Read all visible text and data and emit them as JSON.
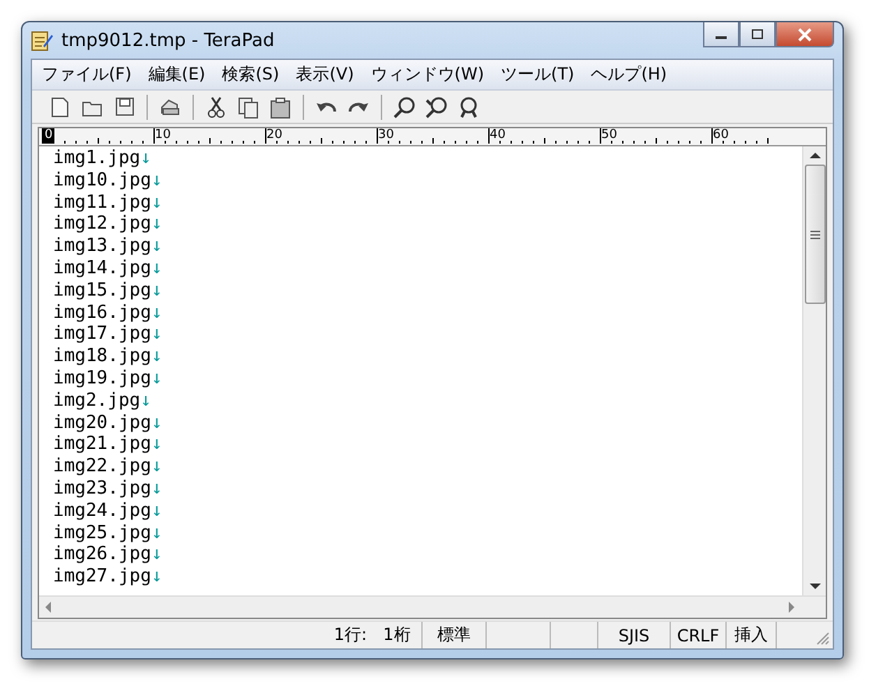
{
  "window": {
    "title": "tmp9012.tmp - TeraPad"
  },
  "menu": [
    "ファイル(F)",
    "編集(E)",
    "検索(S)",
    "表示(V)",
    "ウィンドウ(W)",
    "ツール(T)",
    "ヘルプ(H)"
  ],
  "ruler": [
    "0",
    "10",
    "20",
    "30",
    "40",
    "50",
    "60"
  ],
  "lines": [
    {
      "text": "img1.jpg",
      "eol": "↓"
    },
    {
      "text": "img10.jpg",
      "eol": "↓"
    },
    {
      "text": "img11.jpg",
      "eol": "↓"
    },
    {
      "text": "img12.jpg",
      "eol": "↓"
    },
    {
      "text": "img13.jpg",
      "eol": "↓"
    },
    {
      "text": "img14.jpg",
      "eol": "↓"
    },
    {
      "text": "img15.jpg",
      "eol": "↓"
    },
    {
      "text": "img16.jpg",
      "eol": "↓"
    },
    {
      "text": "img17.jpg",
      "eol": "↓"
    },
    {
      "text": "img18.jpg",
      "eol": "↓"
    },
    {
      "text": "img19.jpg",
      "eol": "↓"
    },
    {
      "text": "img2.jpg",
      "eol": "↓"
    },
    {
      "text": "img20.jpg",
      "eol": "↓"
    },
    {
      "text": "img21.jpg",
      "eol": "↓"
    },
    {
      "text": "img22.jpg",
      "eol": "↓"
    },
    {
      "text": "img23.jpg",
      "eol": "↓"
    },
    {
      "text": "img24.jpg",
      "eol": "↓"
    },
    {
      "text": "img25.jpg",
      "eol": "↓"
    },
    {
      "text": "img26.jpg",
      "eol": "↓"
    },
    {
      "text": "img27.jpg",
      "eol": "↓"
    }
  ],
  "status_bar": {
    "line": "1行:",
    "column": "1桁",
    "mode": "標準",
    "encoding": "SJIS",
    "newline": "CRLF",
    "input": "挿入"
  }
}
